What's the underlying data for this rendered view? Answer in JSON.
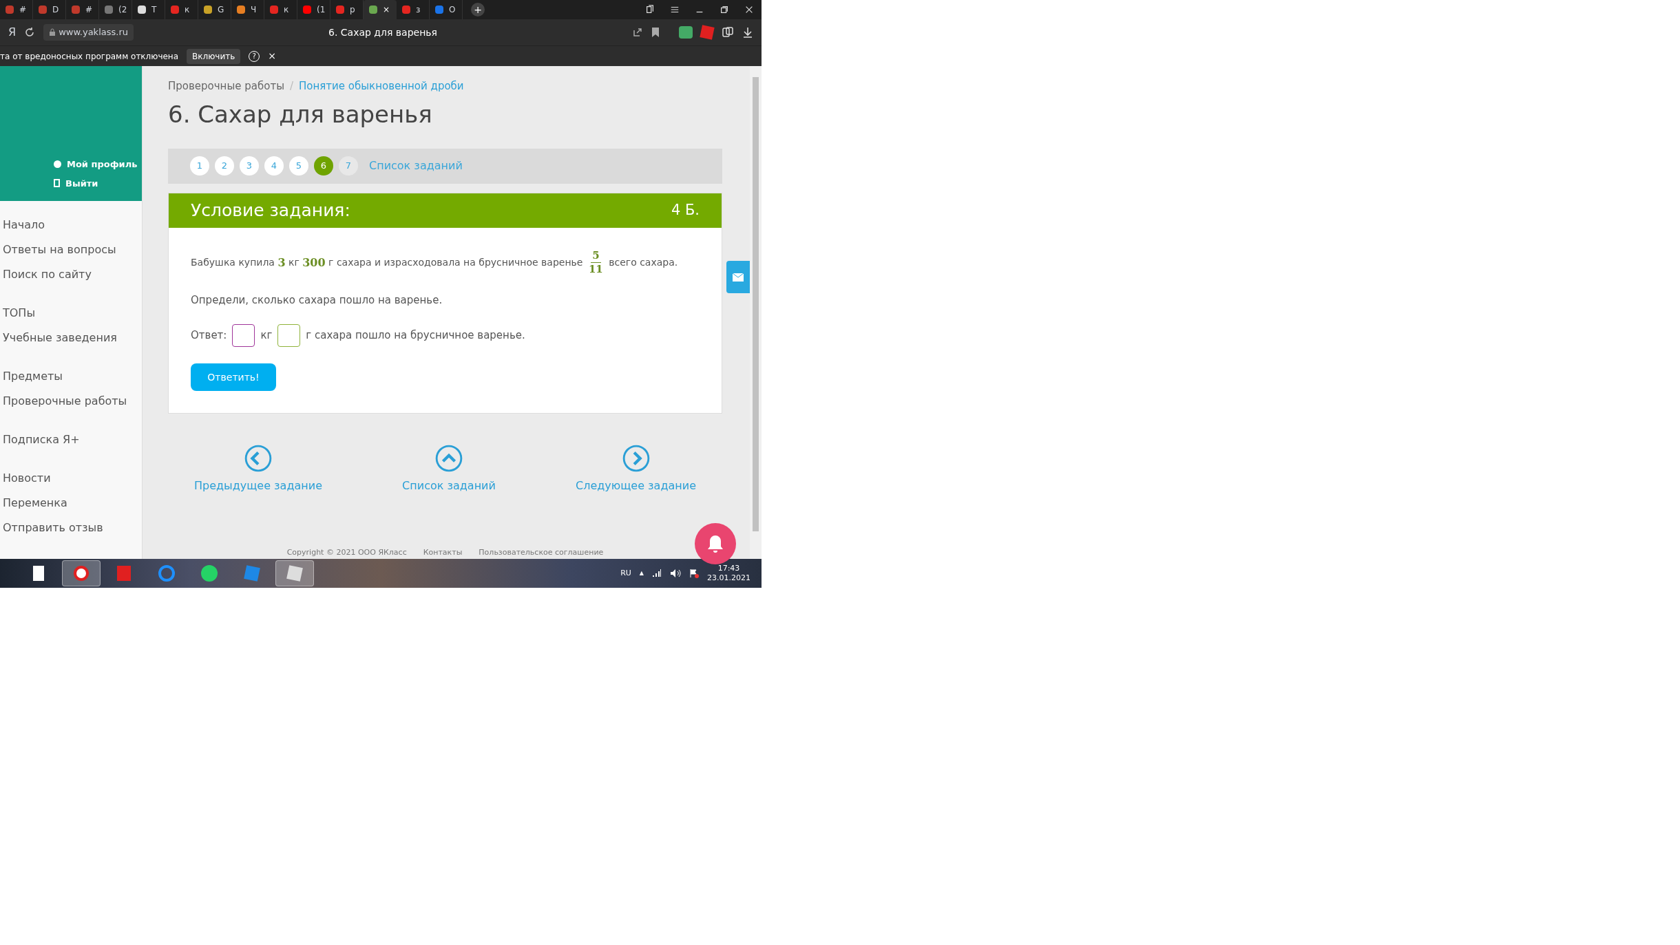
{
  "browser": {
    "tabs": [
      {
        "label": "#",
        "selected": false
      },
      {
        "label": "D",
        "selected": false
      },
      {
        "label": "#",
        "selected": false
      },
      {
        "label": "(2",
        "selected": false
      },
      {
        "label": "T",
        "selected": false
      },
      {
        "label": "к",
        "selected": false
      },
      {
        "label": "G",
        "selected": false
      },
      {
        "label": "Ч",
        "selected": false
      },
      {
        "label": "к",
        "selected": false
      },
      {
        "label": "(1",
        "selected": false
      },
      {
        "label": "p",
        "selected": false
      },
      {
        "label": "×",
        "selected": true
      },
      {
        "label": "з",
        "selected": false
      },
      {
        "label": "O",
        "selected": false
      }
    ],
    "logo": "Я",
    "new_tab": "+",
    "address": "www.yaklass.ru",
    "page_title": "6. Сахар для варенья",
    "notice": {
      "text": "та от вредоносных программ отключена",
      "button": "Включить",
      "help": "?",
      "close": "×"
    }
  },
  "sidebar": {
    "profile_links": [
      "Мой профиль",
      "Выйти"
    ],
    "menu": [
      [
        "Начало",
        "Ответы на вопросы",
        "Поиск по сайту"
      ],
      [
        "ТОПы",
        "Учебные заведения"
      ],
      [
        "Предметы",
        "Проверочные работы"
      ],
      [
        "Подписка Я+"
      ],
      [
        "Новости",
        "Переменка",
        "Отправить отзыв"
      ]
    ]
  },
  "breadcrumb": [
    {
      "label": "Проверочные работы",
      "link": false
    },
    {
      "label": "Понятие обыкновенной дроби",
      "link": true
    }
  ],
  "breadcrumb_separator": "/",
  "title": "6. Сахар для варенья",
  "pager": {
    "pages": [
      {
        "label": "1",
        "selected": false
      },
      {
        "label": "2",
        "selected": false
      },
      {
        "label": "3",
        "selected": false
      },
      {
        "label": "4",
        "selected": false
      },
      {
        "label": "5",
        "selected": false
      },
      {
        "label": "6",
        "selected": true
      },
      {
        "label": "7",
        "selected": false
      }
    ],
    "list_link": "Список заданий"
  },
  "task": {
    "header": "Условие задания:",
    "points": "4 Б.",
    "problem": [
      {
        "kind": "text",
        "text": "Бабушка купила "
      },
      {
        "kind": "number",
        "text": "3"
      },
      {
        "kind": "text",
        "text": " кг "
      },
      {
        "kind": "number",
        "text": "300"
      },
      {
        "kind": "text",
        "text": " г сахара и израсходовала на брусничное варенье "
      },
      {
        "kind": "fraction",
        "numerator": "5",
        "denominator": "11"
      },
      {
        "kind": "text",
        "text": " всего сахара."
      }
    ],
    "question": "Определи, сколько сахара пошло на варенье.",
    "answer": [
      {
        "kind": "text",
        "text": "Ответ:"
      },
      {
        "kind": "input",
        "focused": true
      },
      {
        "kind": "text",
        "text": "кг"
      },
      {
        "kind": "input",
        "focused": false
      },
      {
        "kind": "text",
        "text": "г сахара пошло на брусничное варенье."
      }
    ],
    "submit": "Ответить!"
  },
  "nav": [
    {
      "kind": "prev",
      "label": "Предыдущее задание"
    },
    {
      "kind": "up",
      "label": "Список заданий"
    },
    {
      "kind": "next",
      "label": "Следующее задание"
    }
  ],
  "footer": [
    "Copyright © 2021 ООО ЯКласс",
    "Контакты",
    "Пользовательское соглашение"
  ],
  "taskbar": {
    "apps": [
      {
        "kind": "file",
        "selected": false
      },
      {
        "kind": "ybrowser",
        "selected": true
      },
      {
        "kind": "yandex",
        "selected": false
      },
      {
        "kind": "ie",
        "selected": false
      },
      {
        "kind": "whatsapp",
        "selected": false
      },
      {
        "kind": "roblox",
        "selected": false
      },
      {
        "kind": "studio",
        "selected": true
      }
    ],
    "language": "RU",
    "tray_arrow": "▲",
    "time": "17:43",
    "date": "23.01.2021"
  }
}
